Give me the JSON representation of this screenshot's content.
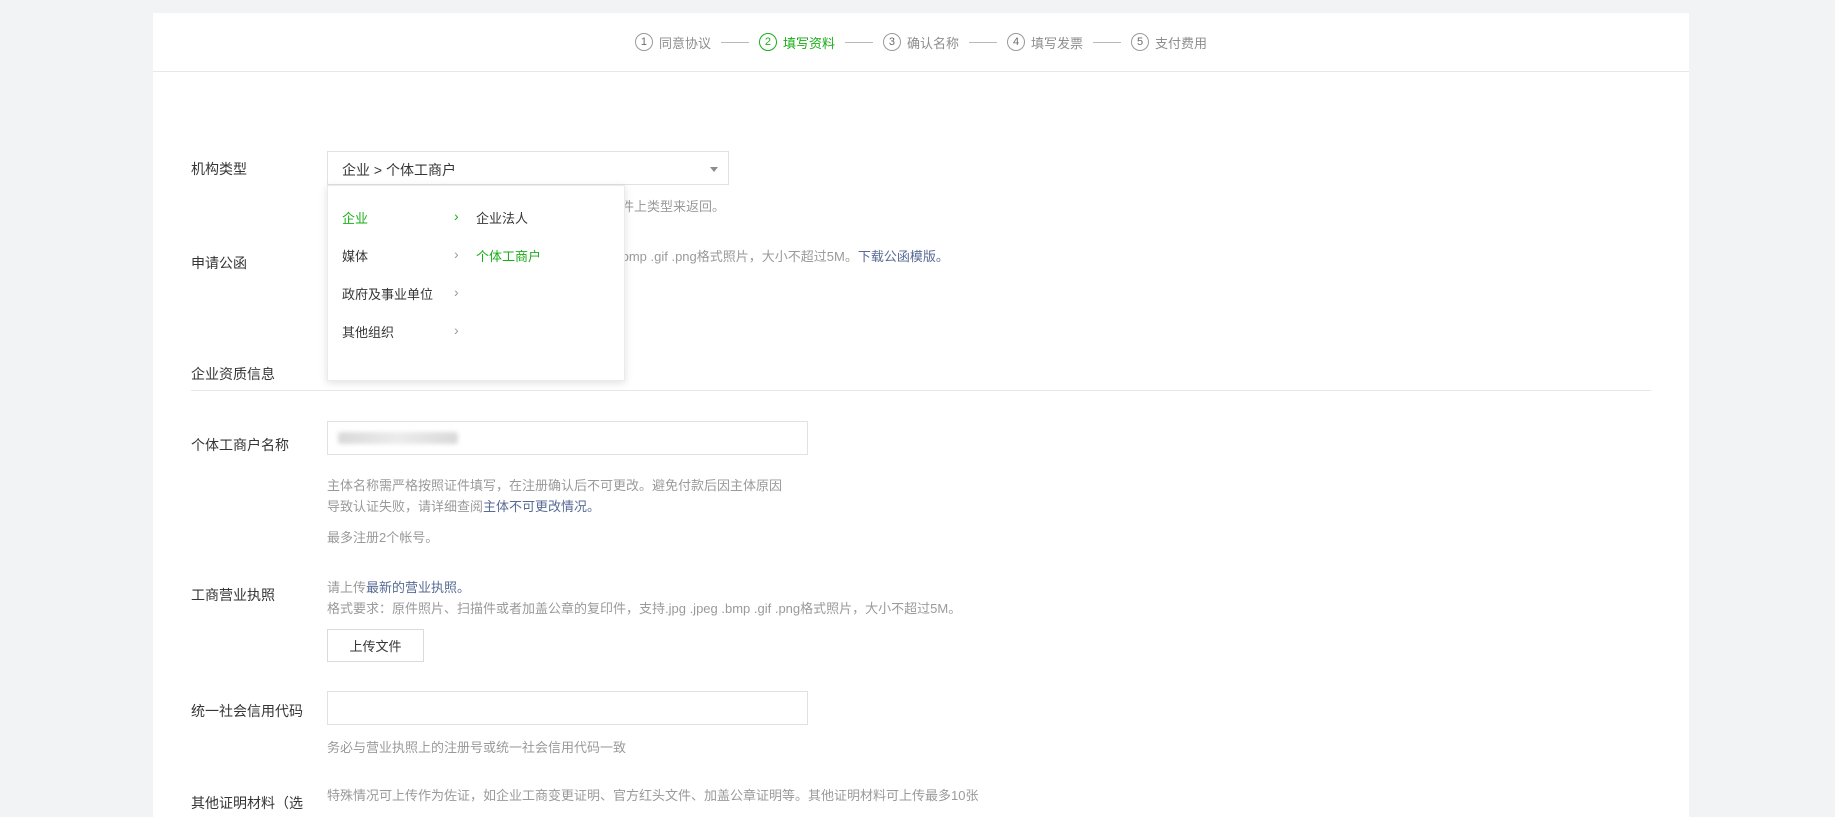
{
  "steps": [
    {
      "num": "1",
      "label": "同意协议",
      "active": false
    },
    {
      "num": "2",
      "label": "填写资料",
      "active": true
    },
    {
      "num": "3",
      "label": "确认名称",
      "active": false
    },
    {
      "num": "4",
      "label": "填写发票",
      "active": false
    },
    {
      "num": "5",
      "label": "支付费用",
      "active": false
    }
  ],
  "form": {
    "org_type_label": "机构类型",
    "org_type_value": "企业 > 个体工商户",
    "org_type_tip_tail": "件上类型来返回。",
    "apply_letter_label": "申请公函",
    "apply_letter_tip_tail": " .bmp .gif .png格式照片，大小不超过5M。",
    "apply_letter_link": "下载公函模版。",
    "section_title": "企业资质信息",
    "name_label": "个体工商户名称",
    "name_tip_1": "主体名称需严格按照证件填写，在注册确认后不可更改。避免付款后因主体原因",
    "name_tip_2a": "导致认证失败，请详细查阅",
    "name_tip_2b": "主体不可更改情况。",
    "name_tip_3": "最多注册2个帐号。",
    "license_label": "工商营业执照",
    "license_tip_1a": "请上传",
    "license_tip_1b": "最新的营业执照。",
    "license_tip_2": "格式要求：原件照片、扫描件或者加盖公章的复印件，支持.jpg .jpeg .bmp .gif .png格式照片，大小不超过5M。",
    "upload_button": "上传文件",
    "credit_code_label": "统一社会信用代码",
    "credit_code_tip": "务必与营业执照上的注册号或统一社会信用代码一致",
    "other_label": "其他证明材料（选",
    "other_tip": "特殊情况可上传作为佐证，如企业工商变更证明、官方红头文件、加盖公章证明等。其他证明材料可上传最多10张"
  },
  "dropdown": {
    "level1": [
      {
        "label": "企业",
        "selected": true
      },
      {
        "label": "媒体",
        "selected": false
      },
      {
        "label": "政府及事业单位",
        "selected": false
      },
      {
        "label": "其他组织",
        "selected": false
      }
    ],
    "level2": [
      {
        "label": "企业法人",
        "selected": false
      },
      {
        "label": "个体工商户",
        "selected": true
      }
    ]
  },
  "colors": {
    "accent": "#1aad19",
    "link": "#576b95"
  }
}
